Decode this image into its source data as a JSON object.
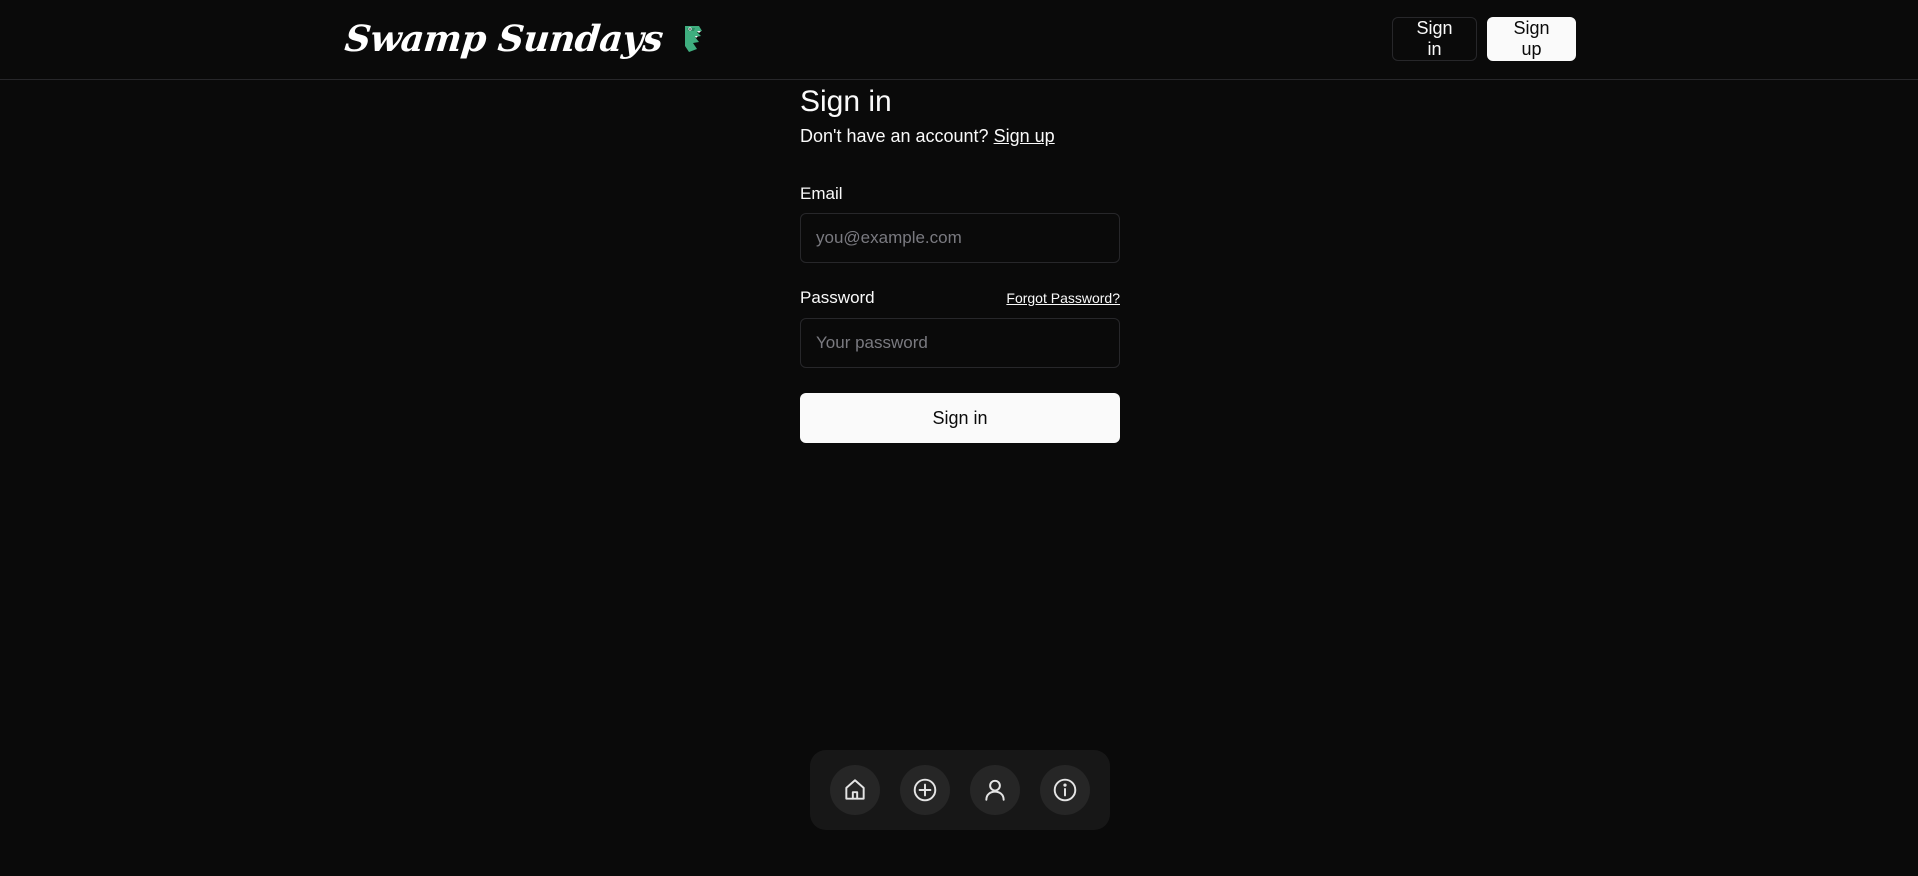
{
  "header": {
    "brand": "Swamp Sundays",
    "brand_icon": "crocodile-icon",
    "sign_in_label": "Sign in",
    "sign_up_label": "Sign up"
  },
  "form": {
    "title": "Sign in",
    "prompt": "Don't have an account?",
    "prompt_link": "Sign up",
    "email_label": "Email",
    "email_placeholder": "you@example.com",
    "password_label": "Password",
    "forgot_label": "Forgot Password?",
    "password_placeholder": "Your password",
    "submit_label": "Sign in"
  },
  "dock": {
    "items": [
      {
        "icon": "home-icon"
      },
      {
        "icon": "plus-circle-icon"
      },
      {
        "icon": "user-icon"
      },
      {
        "icon": "info-icon"
      }
    ]
  },
  "colors": {
    "background": "#0a0a0a",
    "foreground": "#fafafa",
    "border": "#27272a",
    "dock": "#171717",
    "dock_button": "#262626",
    "brand_icon": "#3fae7f"
  }
}
